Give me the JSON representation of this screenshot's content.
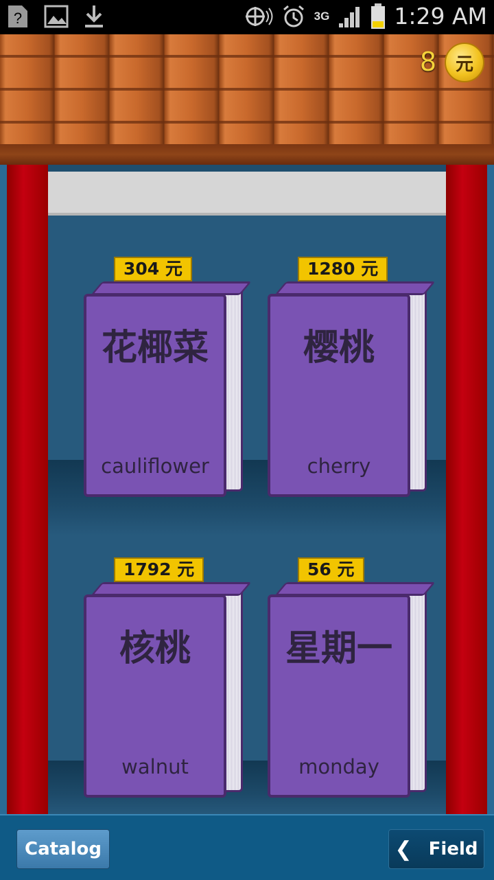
{
  "status_bar": {
    "time": "1:29 AM",
    "network": "3G",
    "icons": [
      "unknown-notification-icon",
      "image-icon",
      "download-icon",
      "sync-icon",
      "alarm-icon",
      "signal-icon",
      "battery-icon"
    ]
  },
  "header": {
    "coin_count": "8",
    "coin_symbol": "元"
  },
  "books": [
    {
      "hanzi": "花椰菜",
      "english": "cauliflower",
      "price": "304 元"
    },
    {
      "hanzi": "樱桃",
      "english": "cherry",
      "price": "1280 元"
    },
    {
      "hanzi": "核桃",
      "english": "walnut",
      "price": "1792 元"
    },
    {
      "hanzi": "星期一",
      "english": "monday",
      "price": "56 元"
    }
  ],
  "footer": {
    "catalog_label": "Catalog",
    "field_label": "Field"
  },
  "colors": {
    "book_cover": "#7a53b3",
    "price_tag": "#f2c400",
    "pillar": "#c40010",
    "coin": "#f2c21f"
  }
}
